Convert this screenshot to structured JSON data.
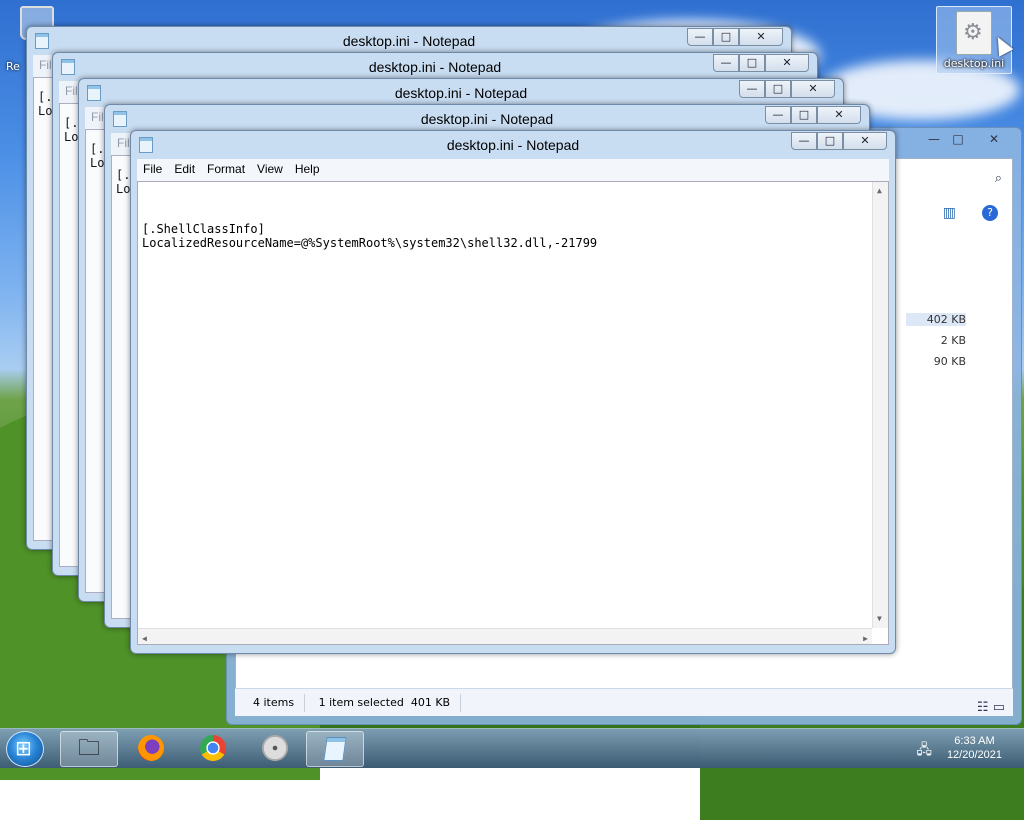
{
  "desktop": {
    "icons": [
      {
        "label": "desktop.ini",
        "icon": "ini-file-icon",
        "selected": true
      },
      {
        "label": "Re",
        "icon": "recycle-bin-icon"
      }
    ]
  },
  "notepad_windows": [
    {
      "title": "desktop.ini - Notepad",
      "menu_faded": true,
      "text_line1": "[.",
      "text_line2": "Lo"
    },
    {
      "title": "desktop.ini - Notepad",
      "menu_faded": true,
      "text_line1": "[.",
      "text_line2": "Lo"
    },
    {
      "title": "desktop.ini - Notepad",
      "menu_faded": true,
      "text_line1": "[.",
      "text_line2": "Lo"
    },
    {
      "title": "desktop.ini - Notepad",
      "menu_faded": true,
      "text_line1": "[.",
      "text_line2": "Lo"
    },
    {
      "title": "desktop.ini - Notepad",
      "menu": {
        "file": "File",
        "edit": "Edit",
        "format": "Format",
        "view": "View",
        "help": "Help"
      },
      "content_line1": "[.ShellClassInfo]",
      "content_line2": "LocalizedResourceName=@%SystemRoot%\\system32\\shell32.dll,-21799"
    }
  ],
  "back_menu_label": "File",
  "window_controls": {
    "minimize": "—",
    "maximize": "□",
    "close": "✕"
  },
  "explorer": {
    "file_sizes": [
      "402 KB",
      "2 KB",
      "90 KB"
    ],
    "status": {
      "items": "4 items",
      "selection": "1 item selected  401 KB"
    }
  },
  "taskbar": {
    "buttons": [
      {
        "name": "explorer-taskbar-button",
        "icon": "folder-icon"
      },
      {
        "name": "firefox-taskbar-button",
        "icon": "firefox-icon"
      },
      {
        "name": "chrome-taskbar-button",
        "icon": "chrome-icon"
      },
      {
        "name": "dvd-taskbar-button",
        "icon": "dvd-icon"
      },
      {
        "name": "notepad-taskbar-button",
        "icon": "notepad-icon",
        "active": true
      }
    ],
    "clock": {
      "time": "6:33 AM",
      "date": "12/20/2021"
    }
  }
}
